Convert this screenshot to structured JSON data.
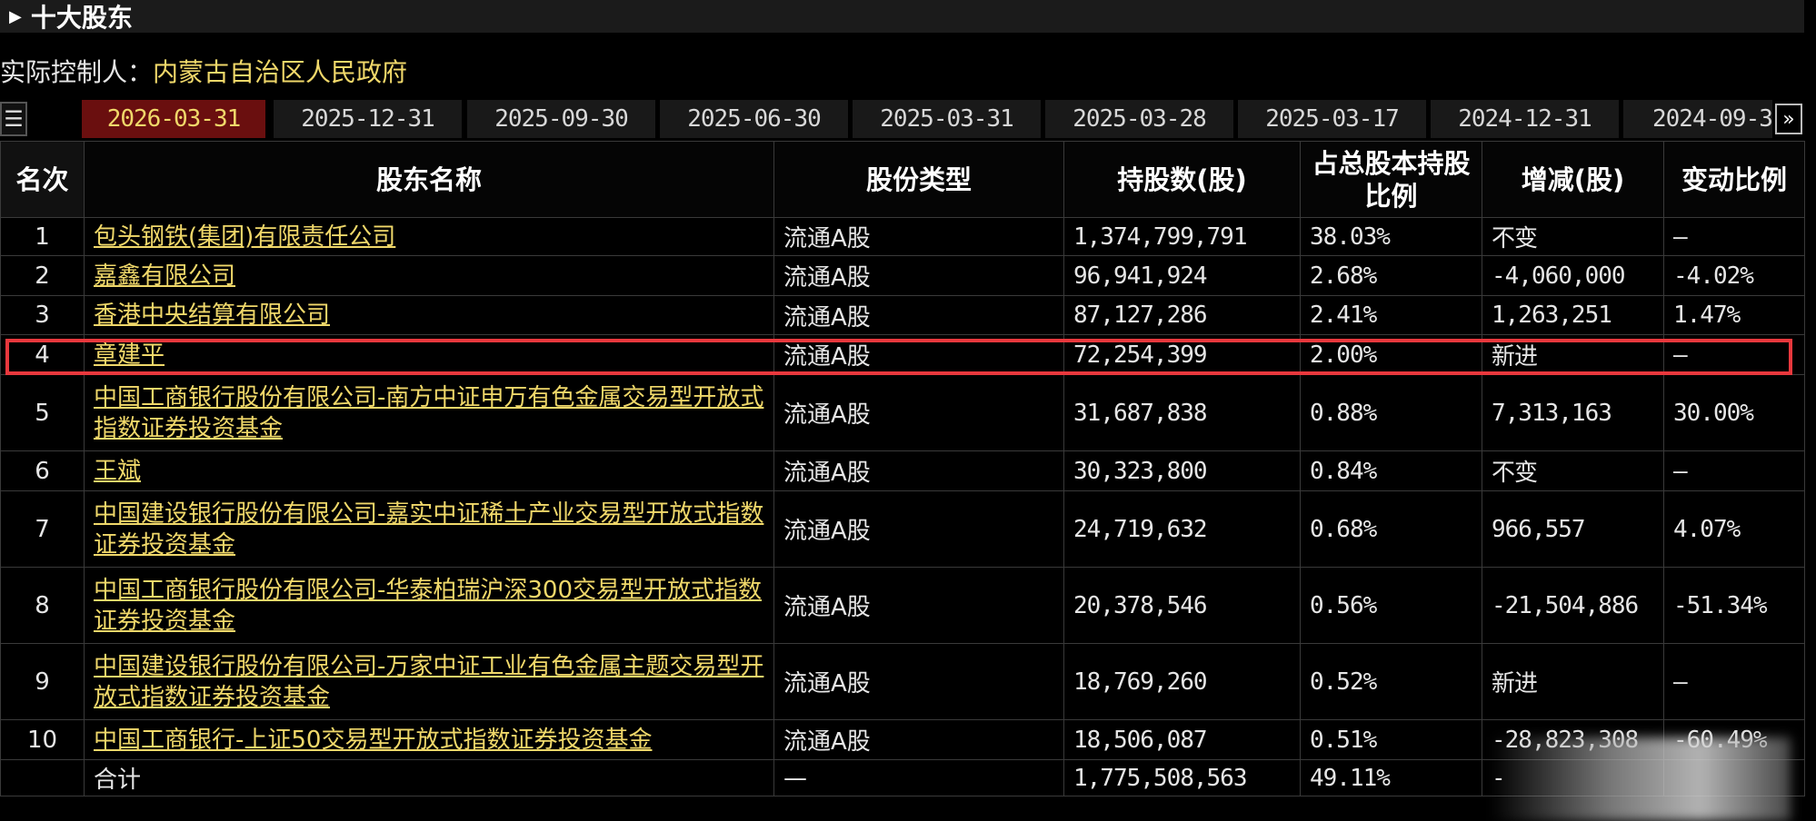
{
  "section": {
    "title": "十大股东"
  },
  "controller": {
    "label": "实际控制人：",
    "value": "内蒙古自治区人民政府"
  },
  "tabs": [
    "2026-03-31",
    "2025-12-31",
    "2025-09-30",
    "2025-06-30",
    "2025-03-31",
    "2025-03-28",
    "2025-03-17",
    "2024-12-31",
    "2024-09-3"
  ],
  "active_tab": 0,
  "icons": {
    "menu": "list-menu-icon",
    "next": "double-chevron-right-icon",
    "section": "triangle-right-icon"
  },
  "colors": {
    "name_link": "#f0d86a",
    "increase": "#ff4a4a",
    "decrease": "#33d16a",
    "active_tab_bg": "#6a0f0f",
    "highlight_border": "#e8383d"
  },
  "table": {
    "headers": [
      "名次",
      "股东名称",
      "股份类型",
      "持股数(股)",
      "占总股本持股比例",
      "增减(股)",
      "变动比例"
    ],
    "rows": [
      {
        "rank": "1",
        "name": "包头钢铁(集团)有限责任公司",
        "type": "流通A股",
        "shares": "1,374,799,791",
        "pct": "38.03%",
        "change": "不变",
        "change_pct": "—",
        "trend": "flat"
      },
      {
        "rank": "2",
        "name": "嘉鑫有限公司",
        "type": "流通A股",
        "shares": "96,941,924",
        "pct": "2.68%",
        "change": "-4,060,000",
        "change_pct": "-4.02%",
        "trend": "down"
      },
      {
        "rank": "3",
        "name": "香港中央结算有限公司",
        "type": "流通A股",
        "shares": "87,127,286",
        "pct": "2.41%",
        "change": "1,263,251",
        "change_pct": "1.47%",
        "trend": "up"
      },
      {
        "rank": "4",
        "name": "章建平",
        "type": "流通A股",
        "shares": "72,254,399",
        "pct": "2.00%",
        "change": "新进",
        "change_pct": "—",
        "trend": "up"
      },
      {
        "rank": "5",
        "name": "中国工商银行股份有限公司-南方中证申万有色金属交易型开放式指数证券投资基金",
        "type": "流通A股",
        "shares": "31,687,838",
        "pct": "0.88%",
        "change": "7,313,163",
        "change_pct": "30.00%",
        "trend": "up"
      },
      {
        "rank": "6",
        "name": "王斌",
        "type": "流通A股",
        "shares": "30,323,800",
        "pct": "0.84%",
        "change": "不变",
        "change_pct": "—",
        "trend": "flat"
      },
      {
        "rank": "7",
        "name": "中国建设银行股份有限公司-嘉实中证稀土产业交易型开放式指数证券投资基金",
        "type": "流通A股",
        "shares": "24,719,632",
        "pct": "0.68%",
        "change": "966,557",
        "change_pct": "4.07%",
        "trend": "up"
      },
      {
        "rank": "8",
        "name": "中国工商银行股份有限公司-华泰柏瑞沪深300交易型开放式指数证券投资基金",
        "type": "流通A股",
        "shares": "20,378,546",
        "pct": "0.56%",
        "change": "-21,504,886",
        "change_pct": "-51.34%",
        "trend": "down"
      },
      {
        "rank": "9",
        "name": "中国建设银行股份有限公司-万家中证工业有色金属主题交易型开放式指数证券投资基金",
        "type": "流通A股",
        "shares": "18,769,260",
        "pct": "0.52%",
        "change": "新进",
        "change_pct": "—",
        "trend": "up"
      },
      {
        "rank": "10",
        "name": "中国工商银行-上证50交易型开放式指数证券投资基金",
        "type": "流通A股",
        "shares": "18,506,087",
        "pct": "0.51%",
        "change": "-28,823,308",
        "change_pct": "-60.49%",
        "trend": "down"
      }
    ],
    "total": {
      "label": "合计",
      "type": "—",
      "shares": "1,775,508,563",
      "pct": "49.11%",
      "change": "-"
    }
  }
}
